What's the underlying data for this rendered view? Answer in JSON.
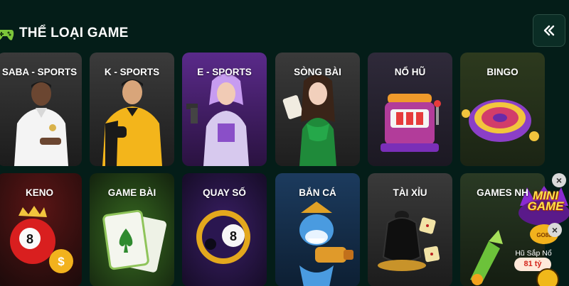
{
  "header": {
    "title": "THỂ LOẠI GAME"
  },
  "categories": [
    {
      "label": "SABA - SPORTS"
    },
    {
      "label": "K - SPORTS"
    },
    {
      "label": "E - SPORTS"
    },
    {
      "label": "SÒNG BÀI"
    },
    {
      "label": "NỔ HŨ"
    },
    {
      "label": "BINGO"
    },
    {
      "label": "KENO"
    },
    {
      "label": "GAME BÀI"
    },
    {
      "label": "QUAY SỐ"
    },
    {
      "label": "BẮN CÁ"
    },
    {
      "label": "TÀI XỈU"
    },
    {
      "label": "GAMES NH"
    }
  ],
  "mini_game": {
    "logo": "MINI GAME",
    "subtitle": "Hũ Sắp Nổ",
    "jackpot": "81 tỷ",
    "close": "×"
  },
  "corner_close": "×",
  "colors": {
    "background": "#041d18",
    "card_dark": "#232323",
    "accent_green": "#8ad93a",
    "accent_gold": "#f0b81a"
  }
}
